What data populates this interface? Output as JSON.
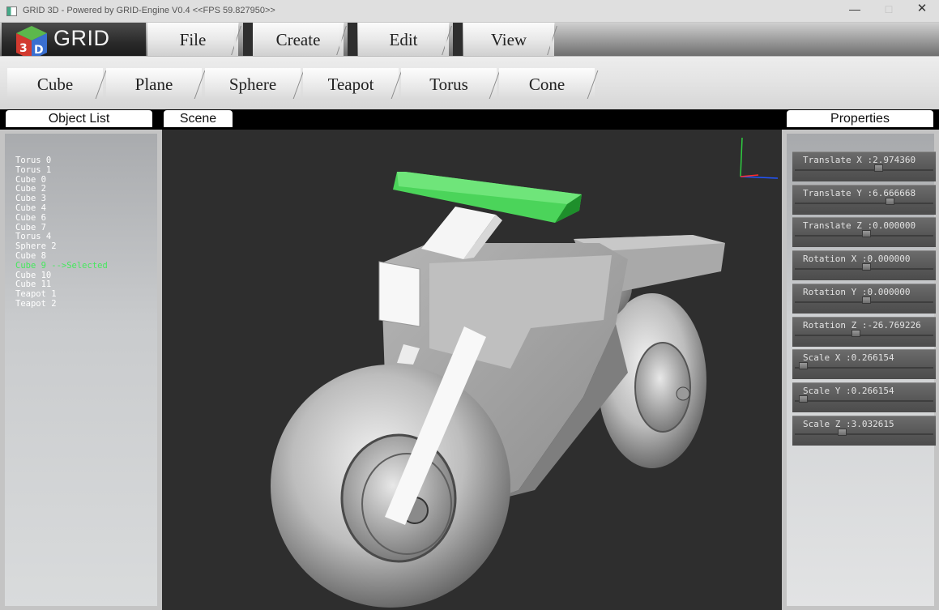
{
  "window": {
    "title": "GRID 3D - Powered by GRID-Engine V0.4 <<FPS 59.827950>>",
    "minimize": "—",
    "maximize": "□",
    "close": "✕"
  },
  "logo": {
    "text": "GRID",
    "icon": "grid-3d-cube-logo"
  },
  "menu": [
    {
      "label": "File"
    },
    {
      "label": "Create"
    },
    {
      "label": "Edit"
    },
    {
      "label": "View"
    }
  ],
  "primitives": [
    {
      "label": "Cube"
    },
    {
      "label": "Plane"
    },
    {
      "label": "Sphere"
    },
    {
      "label": "Teapot"
    },
    {
      "label": "Torus"
    },
    {
      "label": "Cone"
    }
  ],
  "panels": {
    "object_list_title": "Object List",
    "scene_title": "Scene",
    "properties_title": "Properties"
  },
  "objects": [
    {
      "name": "Torus 0"
    },
    {
      "name": "Torus 1"
    },
    {
      "name": "Cube 0"
    },
    {
      "name": "Cube 2"
    },
    {
      "name": "Cube 3"
    },
    {
      "name": "Cube 4"
    },
    {
      "name": "Cube 6"
    },
    {
      "name": "Cube 7"
    },
    {
      "name": "Torus 4"
    },
    {
      "name": "Sphere 2"
    },
    {
      "name": "Cube 8"
    },
    {
      "name": "Cube 9 -->Selected",
      "selected": true
    },
    {
      "name": "Cube 10"
    },
    {
      "name": "Cube 11"
    },
    {
      "name": "Teapot 1"
    },
    {
      "name": "Teapot 2"
    }
  ],
  "selected_color": "#46e85e",
  "properties": [
    {
      "label": "Translate X :2.974360",
      "slider": 0.61
    },
    {
      "label": "Translate Y :6.666668",
      "slider": 0.7
    },
    {
      "label": "Translate Z :0.000000",
      "slider": 0.52
    },
    {
      "label": "Rotation X :0.000000",
      "slider": 0.52
    },
    {
      "label": "Rotation Y :0.000000",
      "slider": 0.52
    },
    {
      "label": "Rotation Z :-26.769226",
      "slider": 0.44
    },
    {
      "label": "Scale X :0.266154",
      "slider": 0.03
    },
    {
      "label": "Scale Y :0.266154",
      "slider": 0.03
    },
    {
      "label": "Scale Z :3.032615",
      "slider": 0.33
    }
  ]
}
